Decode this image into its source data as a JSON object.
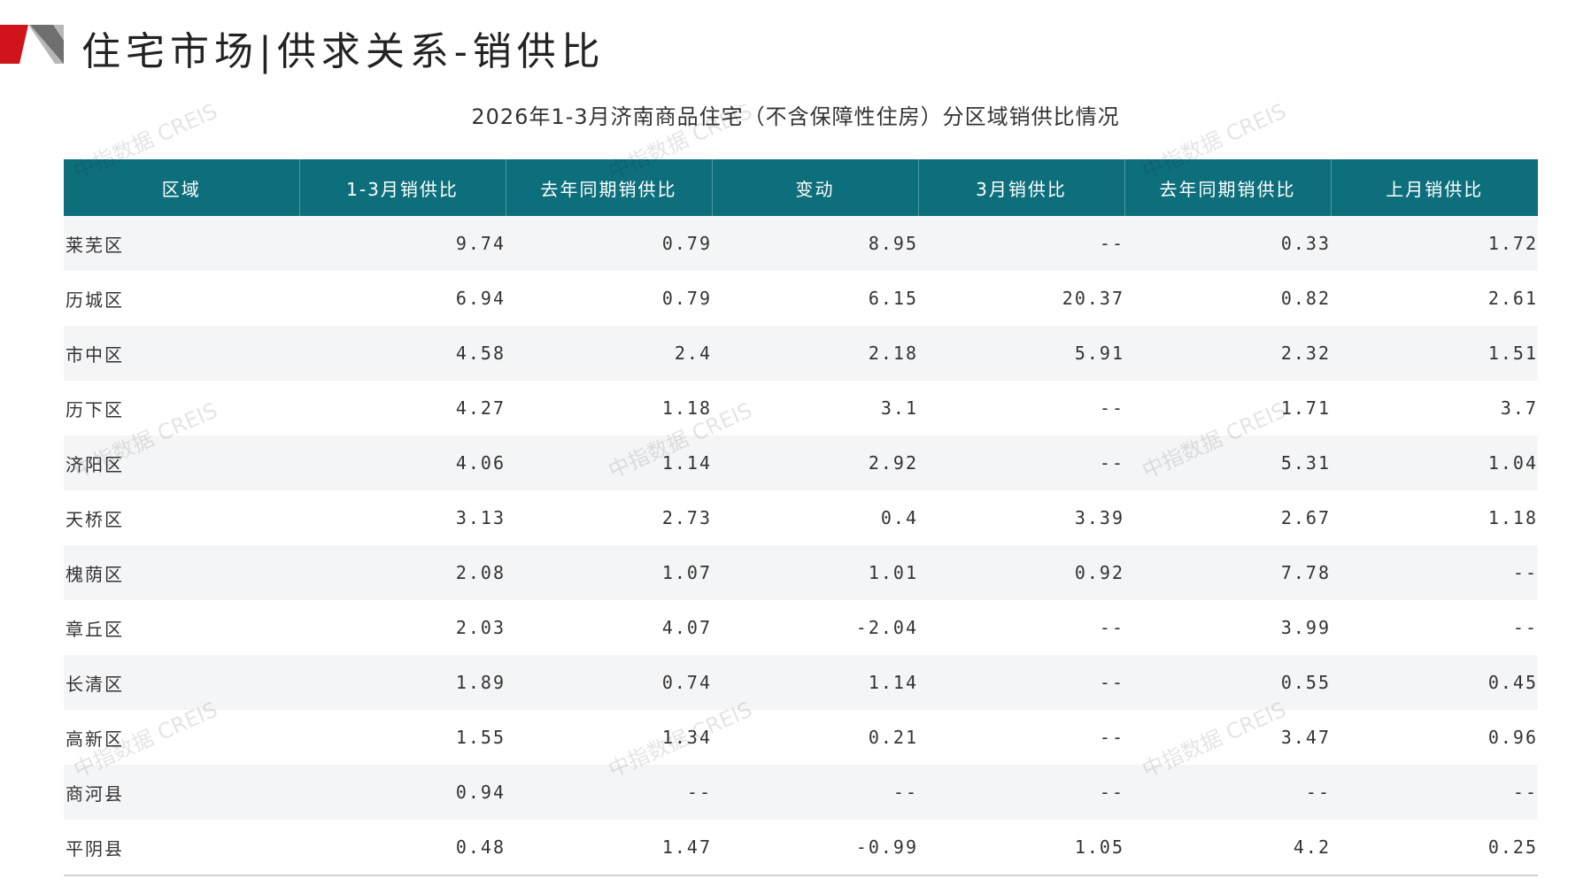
{
  "page": {
    "title": "住宅市场|供求关系-销供比",
    "caption": "2026年1-3月济南商品住宅（不含保障性住房）分区域销供比情况",
    "watermark": "中指数据 CREIS",
    "colors": {
      "header_bg": "#0e6f7c",
      "accent_red": "#d0141c",
      "stripe": "#f4f5f6"
    }
  },
  "table": {
    "headers": [
      "区域",
      "1-3月销供比",
      "去年同期销供比",
      "变动",
      "3月销供比",
      "去年同期销供比",
      "上月销供比"
    ],
    "rows": [
      [
        "莱芜区",
        "9.74",
        "0.79",
        "8.95",
        "--",
        "0.33",
        "1.72"
      ],
      [
        "历城区",
        "6.94",
        "0.79",
        "6.15",
        "20.37",
        "0.82",
        "2.61"
      ],
      [
        "市中区",
        "4.58",
        "2.4",
        "2.18",
        "5.91",
        "2.32",
        "1.51"
      ],
      [
        "历下区",
        "4.27",
        "1.18",
        "3.1",
        "--",
        "1.71",
        "3.7"
      ],
      [
        "济阳区",
        "4.06",
        "1.14",
        "2.92",
        "--",
        "5.31",
        "1.04"
      ],
      [
        "天桥区",
        "3.13",
        "2.73",
        "0.4",
        "3.39",
        "2.67",
        "1.18"
      ],
      [
        "槐荫区",
        "2.08",
        "1.07",
        "1.01",
        "0.92",
        "7.78",
        "--"
      ],
      [
        "章丘区",
        "2.03",
        "4.07",
        "-2.04",
        "--",
        "3.99",
        "--"
      ],
      [
        "长清区",
        "1.89",
        "0.74",
        "1.14",
        "--",
        "0.55",
        "0.45"
      ],
      [
        "高新区",
        "1.55",
        "1.34",
        "0.21",
        "--",
        "3.47",
        "0.96"
      ],
      [
        "商河县",
        "0.94",
        "--",
        "--",
        "--",
        "--",
        "--"
      ],
      [
        "平阴县",
        "0.48",
        "1.47",
        "-0.99",
        "1.05",
        "4.2",
        "0.25"
      ]
    ]
  }
}
